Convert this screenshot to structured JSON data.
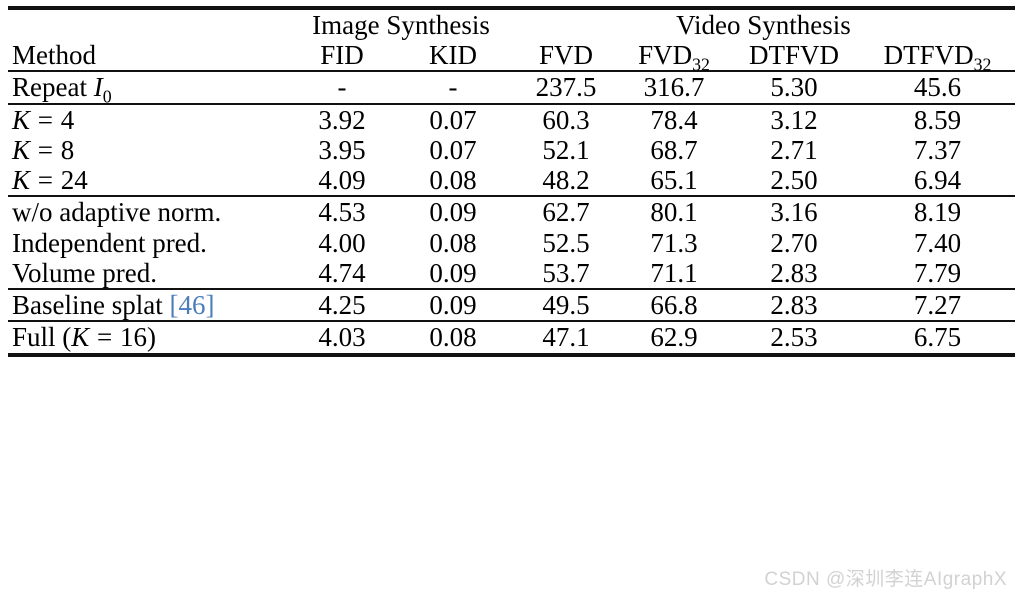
{
  "table": {
    "group_headers": [
      {
        "label": "",
        "span": 1
      },
      {
        "label": "Image Synthesis",
        "span": 2
      },
      {
        "label": "Video Synthesis",
        "span": 4
      }
    ],
    "group_image_label": "Image Synthesis",
    "group_video_label": "Video Synthesis",
    "columns": {
      "method": "Method",
      "fid": "FID",
      "kid": "KID",
      "fvd": "FVD",
      "fvd32_base": "FVD",
      "fvd32_sub": "32",
      "dtfvd": "DTFVD",
      "dtfvd32_base": "DTFVD",
      "dtfvd32_sub": "32"
    },
    "sections": [
      {
        "rows": [
          {
            "method_prefix": "Repeat ",
            "method_var": "I",
            "method_sub": "0",
            "method_suffix": "",
            "fid": "-",
            "kid": "-",
            "fvd": "237.5",
            "fvd32": "316.7",
            "dtfvd": "5.30",
            "dtfvd32": "45.6"
          }
        ]
      },
      {
        "rows": [
          {
            "method_var": "K",
            "method_eq": " = ",
            "method_val": "4",
            "fid": "3.92",
            "kid": "0.07",
            "fvd": "60.3",
            "fvd32": "78.4",
            "dtfvd": "3.12",
            "dtfvd32": "8.59"
          },
          {
            "method_var": "K",
            "method_eq": " = ",
            "method_val": "8",
            "fid": "3.95",
            "kid": "0.07",
            "fvd": "52.1",
            "fvd32": "68.7",
            "dtfvd": "2.71",
            "dtfvd32": "7.37"
          },
          {
            "method_var": "K",
            "method_eq": " = ",
            "method_val": "24",
            "fid": "4.09",
            "kid": "0.08",
            "fvd": "48.2",
            "fvd32": "65.1",
            "dtfvd": "2.50",
            "dtfvd32": "6.94"
          }
        ]
      },
      {
        "rows": [
          {
            "method": "w/o adaptive norm.",
            "fid": "4.53",
            "kid": "0.09",
            "fvd": "62.7",
            "fvd32": "80.1",
            "dtfvd": "3.16",
            "dtfvd32": "8.19"
          },
          {
            "method": "Independent pred.",
            "fid": "4.00",
            "kid": "0.08",
            "fvd": "52.5",
            "fvd32": "71.3",
            "dtfvd": "2.70",
            "dtfvd32": "7.40"
          },
          {
            "method": "Volume pred.",
            "fid": "4.74",
            "kid": "0.09",
            "fvd": "53.7",
            "fvd32": "71.1",
            "dtfvd": "2.83",
            "dtfvd32": "7.79"
          }
        ]
      },
      {
        "rows": [
          {
            "method_prefix": "Baseline splat ",
            "method_cite": "[46]",
            "fid": "4.25",
            "kid": "0.09",
            "fvd": "49.5",
            "fvd32": "66.8",
            "dtfvd": "2.83",
            "dtfvd32": "7.27"
          }
        ]
      },
      {
        "rows": [
          {
            "method_prefix": "Full (",
            "method_var": "K",
            "method_eq": " = ",
            "method_val": "16",
            "method_suffix": ")",
            "fid": "4.03",
            "kid": "0.08",
            "fvd": "47.1",
            "fvd32": "62.9",
            "dtfvd": "2.53",
            "dtfvd32": "6.75"
          }
        ]
      }
    ]
  },
  "watermark": {
    "text": "CSDN @深圳李连AIgraphX"
  },
  "colors": {
    "citation_link": "#4a7ebb",
    "rule": "#111111",
    "watermark": "#d2d2d2"
  }
}
